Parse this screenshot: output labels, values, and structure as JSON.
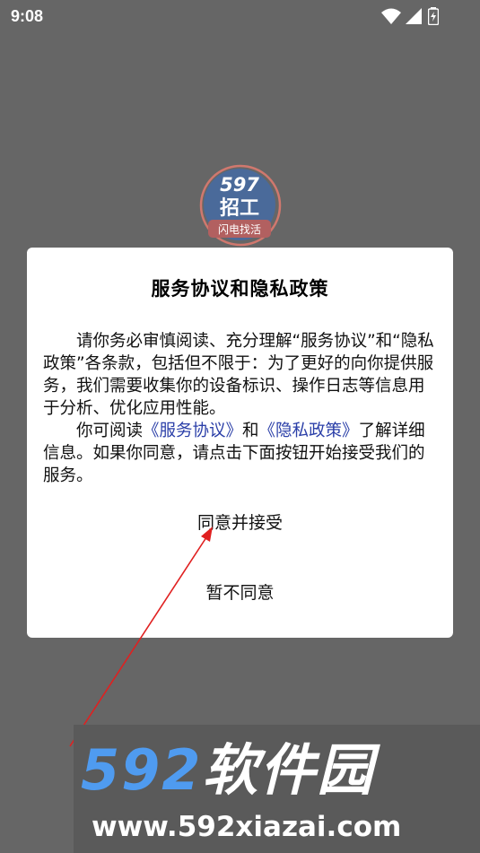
{
  "status_bar": {
    "time": "9:08",
    "icons": [
      "wifi-icon",
      "signal-icon",
      "battery-charging-icon"
    ]
  },
  "app": {
    "logo_number": "597",
    "logo_text": "招工",
    "logo_tagline": "闪电找活",
    "logo_colors": {
      "ring": "#d94a3a",
      "fill": "#2d5bb8"
    }
  },
  "dialog": {
    "title": "服务协议和隐私政策",
    "paragraph1": "请你务必审慎阅读、充分理解“服务协议”和“隐私政策”各条款，包括但不限于：为了更好的向你提供服务，我们需要收集你的设备标识、操作日志等信息用于分析、优化应用性能。",
    "paragraph2_pre": "你可阅读",
    "link_terms": "《服务协议》",
    "paragraph2_and": "和",
    "link_privacy": "《隐私政策》",
    "paragraph2_post": "了解详细信息。如果你同意，请点击下面按钮开始接受我们的服务。",
    "accept_label": "同意并接受",
    "decline_label": "暂不同意",
    "link_color": "#2b3fa8"
  },
  "annotation": {
    "arrow_color": "#e02020"
  },
  "watermark": {
    "brand_number": "592",
    "brand_text": "软件园",
    "url": "www.592xiazai.com",
    "number_color": "#4f9bf0"
  }
}
